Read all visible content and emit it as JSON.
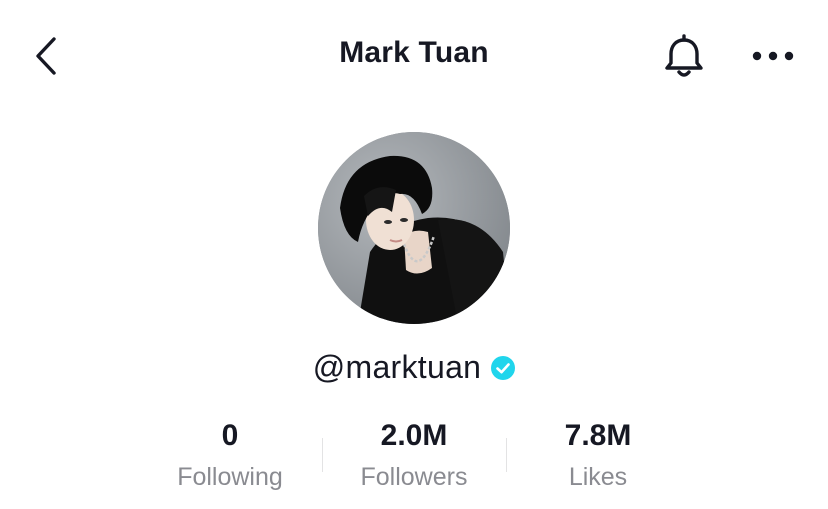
{
  "header": {
    "title": "Mark Tuan",
    "back_icon": "chevron-left-icon",
    "bell_icon": "bell-icon",
    "more_icon": "more-horizontal-icon"
  },
  "profile": {
    "handle": "@marktuan",
    "verified_icon": "verified-badge-icon",
    "verified_color": "#20d5ec"
  },
  "stats": [
    {
      "value": "0",
      "label": "Following"
    },
    {
      "value": "2.0M",
      "label": "Followers"
    },
    {
      "value": "7.8M",
      "label": "Likes"
    }
  ],
  "colors": {
    "text_primary": "#161823",
    "text_secondary": "#8a8b91",
    "divider": "#e3e3e4"
  }
}
